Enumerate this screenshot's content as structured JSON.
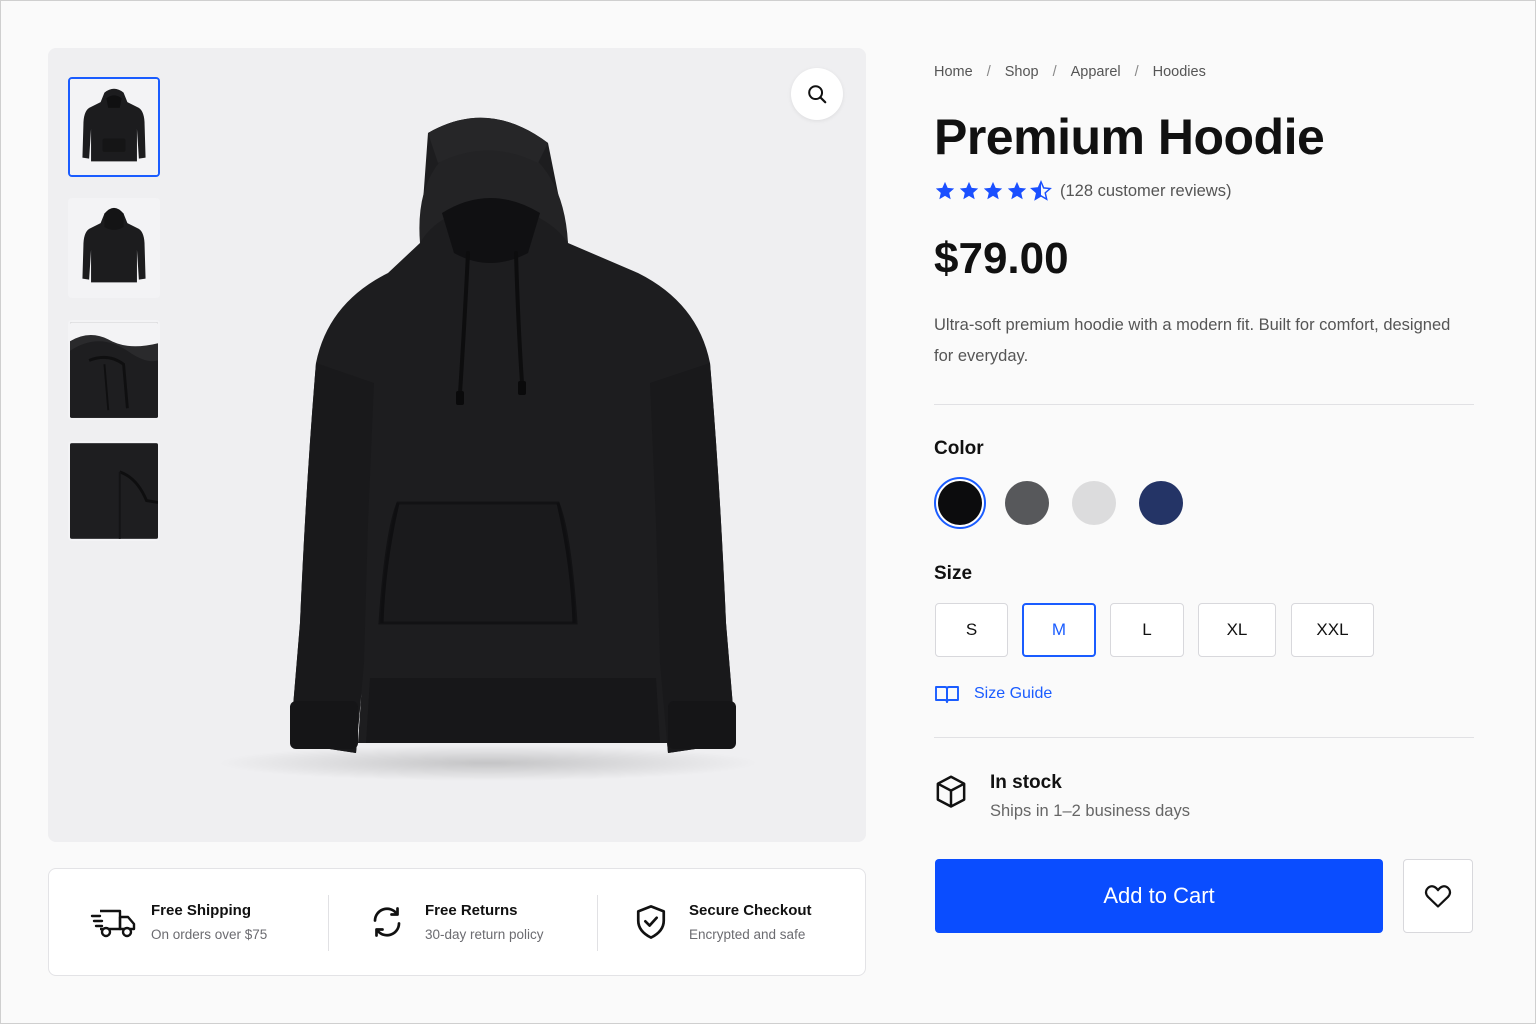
{
  "gallery": {
    "thumbnails": [
      {
        "name": "front-view",
        "active": true
      },
      {
        "name": "back-view",
        "active": false
      },
      {
        "name": "hood-detail",
        "active": false
      },
      {
        "name": "pocket-detail",
        "active": false
      }
    ],
    "zoom_icon": "search-icon"
  },
  "features": [
    {
      "icon": "truck-icon",
      "title": "Free Shipping",
      "subtitle": "On orders over $75"
    },
    {
      "icon": "refresh-icon",
      "title": "Free Returns",
      "subtitle": "30-day return policy"
    },
    {
      "icon": "shield-check-icon",
      "title": "Secure Checkout",
      "subtitle": "Encrypted and safe"
    }
  ],
  "breadcrumb": [
    "Home",
    "Shop",
    "Apparel",
    "Hoodies"
  ],
  "breadcrumb_separator": "/",
  "product": {
    "title": "Premium Hoodie",
    "rating": 4.5,
    "rating_max": 5,
    "reviews_text": "(128 customer reviews)",
    "price": "$79.00",
    "description": "Ultra-soft premium hoodie with a modern fit. Built for comfort, designed for everyday."
  },
  "color": {
    "label": "Color",
    "options": [
      {
        "name": "black",
        "hex": "#0c0c0d",
        "selected": true
      },
      {
        "name": "charcoal",
        "hex": "#57585b",
        "selected": false
      },
      {
        "name": "light-gray",
        "hex": "#dcdcdd",
        "selected": false
      },
      {
        "name": "navy",
        "hex": "#243466",
        "selected": false
      }
    ]
  },
  "size": {
    "label": "Size",
    "options": [
      "S",
      "M",
      "L",
      "XL",
      "XXL"
    ],
    "selected": "M",
    "guide_label": "Size Guide"
  },
  "stock": {
    "status": "In stock",
    "shipping": "Ships in 1–2 business days"
  },
  "actions": {
    "add_to_cart": "Add to Cart",
    "wishlist_icon": "heart-icon"
  },
  "colors": {
    "accent": "#0a4dff",
    "star": "#1a4fff"
  }
}
